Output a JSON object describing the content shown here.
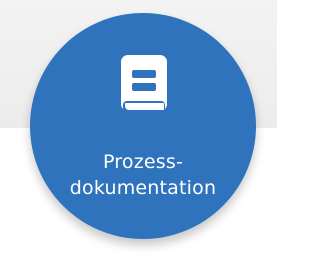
{
  "card": {
    "icon": "book-icon",
    "label_line_1": "Prozess-",
    "label_line_2": "dokumentation",
    "accent_color": "#2f73bd"
  }
}
